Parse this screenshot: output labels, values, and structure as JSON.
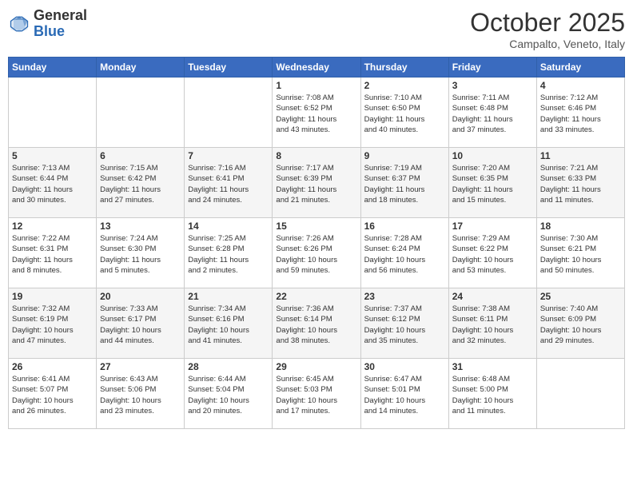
{
  "header": {
    "logo": {
      "line1": "General",
      "line2": "Blue"
    },
    "title": "October 2025",
    "subtitle": "Campalto, Veneto, Italy"
  },
  "weekdays": [
    "Sunday",
    "Monday",
    "Tuesday",
    "Wednesday",
    "Thursday",
    "Friday",
    "Saturday"
  ],
  "weeks": [
    [
      {
        "day": "",
        "info": ""
      },
      {
        "day": "",
        "info": ""
      },
      {
        "day": "",
        "info": ""
      },
      {
        "day": "1",
        "info": "Sunrise: 7:08 AM\nSunset: 6:52 PM\nDaylight: 11 hours\nand 43 minutes."
      },
      {
        "day": "2",
        "info": "Sunrise: 7:10 AM\nSunset: 6:50 PM\nDaylight: 11 hours\nand 40 minutes."
      },
      {
        "day": "3",
        "info": "Sunrise: 7:11 AM\nSunset: 6:48 PM\nDaylight: 11 hours\nand 37 minutes."
      },
      {
        "day": "4",
        "info": "Sunrise: 7:12 AM\nSunset: 6:46 PM\nDaylight: 11 hours\nand 33 minutes."
      }
    ],
    [
      {
        "day": "5",
        "info": "Sunrise: 7:13 AM\nSunset: 6:44 PM\nDaylight: 11 hours\nand 30 minutes."
      },
      {
        "day": "6",
        "info": "Sunrise: 7:15 AM\nSunset: 6:42 PM\nDaylight: 11 hours\nand 27 minutes."
      },
      {
        "day": "7",
        "info": "Sunrise: 7:16 AM\nSunset: 6:41 PM\nDaylight: 11 hours\nand 24 minutes."
      },
      {
        "day": "8",
        "info": "Sunrise: 7:17 AM\nSunset: 6:39 PM\nDaylight: 11 hours\nand 21 minutes."
      },
      {
        "day": "9",
        "info": "Sunrise: 7:19 AM\nSunset: 6:37 PM\nDaylight: 11 hours\nand 18 minutes."
      },
      {
        "day": "10",
        "info": "Sunrise: 7:20 AM\nSunset: 6:35 PM\nDaylight: 11 hours\nand 15 minutes."
      },
      {
        "day": "11",
        "info": "Sunrise: 7:21 AM\nSunset: 6:33 PM\nDaylight: 11 hours\nand 11 minutes."
      }
    ],
    [
      {
        "day": "12",
        "info": "Sunrise: 7:22 AM\nSunset: 6:31 PM\nDaylight: 11 hours\nand 8 minutes."
      },
      {
        "day": "13",
        "info": "Sunrise: 7:24 AM\nSunset: 6:30 PM\nDaylight: 11 hours\nand 5 minutes."
      },
      {
        "day": "14",
        "info": "Sunrise: 7:25 AM\nSunset: 6:28 PM\nDaylight: 11 hours\nand 2 minutes."
      },
      {
        "day": "15",
        "info": "Sunrise: 7:26 AM\nSunset: 6:26 PM\nDaylight: 10 hours\nand 59 minutes."
      },
      {
        "day": "16",
        "info": "Sunrise: 7:28 AM\nSunset: 6:24 PM\nDaylight: 10 hours\nand 56 minutes."
      },
      {
        "day": "17",
        "info": "Sunrise: 7:29 AM\nSunset: 6:22 PM\nDaylight: 10 hours\nand 53 minutes."
      },
      {
        "day": "18",
        "info": "Sunrise: 7:30 AM\nSunset: 6:21 PM\nDaylight: 10 hours\nand 50 minutes."
      }
    ],
    [
      {
        "day": "19",
        "info": "Sunrise: 7:32 AM\nSunset: 6:19 PM\nDaylight: 10 hours\nand 47 minutes."
      },
      {
        "day": "20",
        "info": "Sunrise: 7:33 AM\nSunset: 6:17 PM\nDaylight: 10 hours\nand 44 minutes."
      },
      {
        "day": "21",
        "info": "Sunrise: 7:34 AM\nSunset: 6:16 PM\nDaylight: 10 hours\nand 41 minutes."
      },
      {
        "day": "22",
        "info": "Sunrise: 7:36 AM\nSunset: 6:14 PM\nDaylight: 10 hours\nand 38 minutes."
      },
      {
        "day": "23",
        "info": "Sunrise: 7:37 AM\nSunset: 6:12 PM\nDaylight: 10 hours\nand 35 minutes."
      },
      {
        "day": "24",
        "info": "Sunrise: 7:38 AM\nSunset: 6:11 PM\nDaylight: 10 hours\nand 32 minutes."
      },
      {
        "day": "25",
        "info": "Sunrise: 7:40 AM\nSunset: 6:09 PM\nDaylight: 10 hours\nand 29 minutes."
      }
    ],
    [
      {
        "day": "26",
        "info": "Sunrise: 6:41 AM\nSunset: 5:07 PM\nDaylight: 10 hours\nand 26 minutes."
      },
      {
        "day": "27",
        "info": "Sunrise: 6:43 AM\nSunset: 5:06 PM\nDaylight: 10 hours\nand 23 minutes."
      },
      {
        "day": "28",
        "info": "Sunrise: 6:44 AM\nSunset: 5:04 PM\nDaylight: 10 hours\nand 20 minutes."
      },
      {
        "day": "29",
        "info": "Sunrise: 6:45 AM\nSunset: 5:03 PM\nDaylight: 10 hours\nand 17 minutes."
      },
      {
        "day": "30",
        "info": "Sunrise: 6:47 AM\nSunset: 5:01 PM\nDaylight: 10 hours\nand 14 minutes."
      },
      {
        "day": "31",
        "info": "Sunrise: 6:48 AM\nSunset: 5:00 PM\nDaylight: 10 hours\nand 11 minutes."
      },
      {
        "day": "",
        "info": ""
      }
    ]
  ]
}
